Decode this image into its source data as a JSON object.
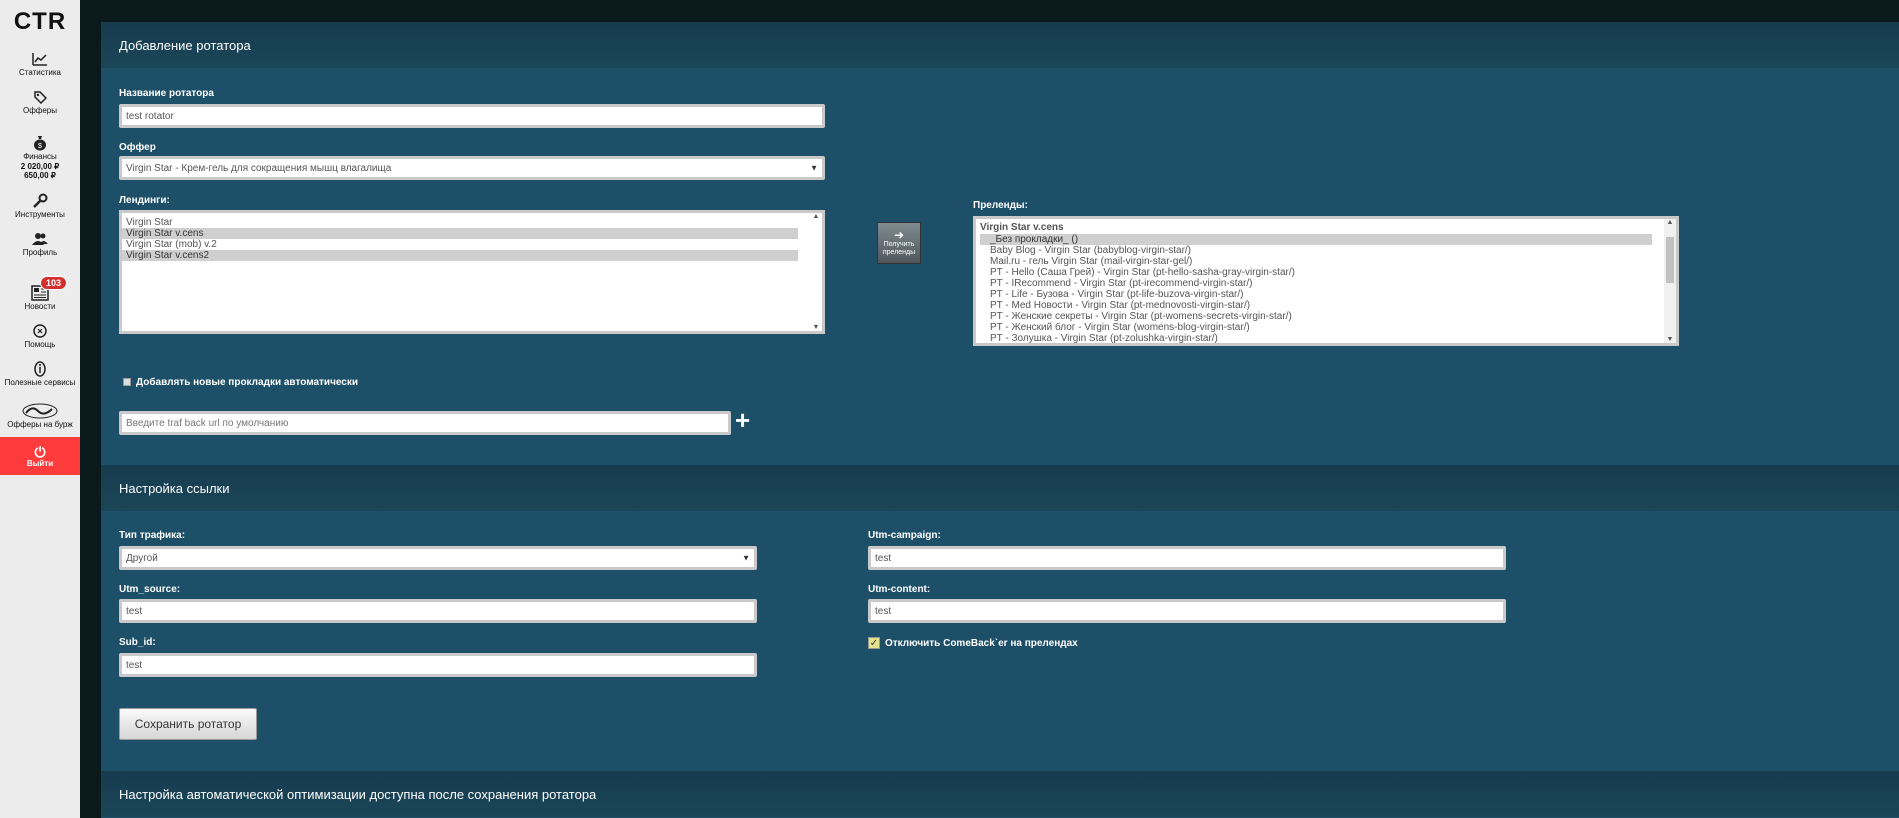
{
  "sidebar": {
    "logo": "CTR",
    "items": [
      {
        "label": "Статистика",
        "icon": "chart-icon"
      },
      {
        "label": "Офферы",
        "icon": "tag-icon"
      },
      {
        "label": "Финансы",
        "icon": "money-bag-icon",
        "balance1": "2 020,00 ₽",
        "balance2": "650,00 ₽"
      },
      {
        "label": "Инструменты",
        "icon": "wrench-icon"
      },
      {
        "label": "Профиль",
        "icon": "users-icon"
      },
      {
        "label": "Новости",
        "icon": "newspaper-icon",
        "badge": "103"
      },
      {
        "label": "Помощь",
        "icon": "help-icon"
      },
      {
        "label": "Полезные сервисы",
        "icon": "info-icon"
      },
      {
        "label": "Офферы на бурж",
        "icon": "adcombo-logo"
      }
    ],
    "logout": {
      "label": "Выйти",
      "icon": "power-icon"
    }
  },
  "section1": {
    "title": "Добавление ротатора",
    "name_label": "Название ротатора",
    "name_value": "test rotator",
    "offer_label": "Оффер",
    "offer_value": "Virgin Star - Крем-гель для сокращения мышц влагалища",
    "landings_label": "Лендинги:",
    "landings": [
      {
        "text": "Virgin Star",
        "selected": false
      },
      {
        "text": "Virgin Star v.cens",
        "selected": true
      },
      {
        "text": "Virgin Star (mob) v.2",
        "selected": false
      },
      {
        "text": "Virgin Star v.cens2",
        "selected": true
      }
    ],
    "get_prelands_btn": "Получить преленды",
    "prelands_label": "Преленды:",
    "prelands_group": "Virgin Star v.cens",
    "prelands": [
      {
        "text": "_Без прокладки_ ()",
        "selected": true
      },
      {
        "text": "Baby Blog - Virgin Star (babyblog-virgin-star/)",
        "selected": false
      },
      {
        "text": "Mail.ru - гель Virgin Star (mail-virgin-star-gel/)",
        "selected": false
      },
      {
        "text": "PT - Hello (Саша Грей) - Virgin Star (pt-hello-sasha-gray-virgin-star/)",
        "selected": false
      },
      {
        "text": "PT - IRecommend - Virgin Star (pt-irecommend-virgin-star/)",
        "selected": false
      },
      {
        "text": "PT - Life - Бузова - Virgin Star (pt-life-buzova-virgin-star/)",
        "selected": false
      },
      {
        "text": "PT - Med Новости - Virgin Star (pt-mednovosti-virgin-star/)",
        "selected": false
      },
      {
        "text": "PT - Женские секреты - Virgin Star (pt-womens-secrets-virgin-star/)",
        "selected": false
      },
      {
        "text": "PT - Женский блог - Virgin Star (womens-blog-virgin-star/)",
        "selected": false
      },
      {
        "text": "PT - Золушка - Virgin Star (pt-zolushka-virgin-star/)",
        "selected": false
      }
    ],
    "auto_add_label": "Добавлять новые прокладки автоматически",
    "trafback_placeholder": "Введите traf back url по умолчанию"
  },
  "section2": {
    "title": "Настройка ссылки",
    "traffic_type_label": "Тип трафика:",
    "traffic_type_value": "Другой",
    "utm_source_label": "Utm_source:",
    "utm_source_value": "test",
    "sub_id_label": "Sub_id:",
    "sub_id_value": "test",
    "utm_campaign_label": "Utm-campaign:",
    "utm_campaign_value": "test",
    "utm_content_label": "Utm-content:",
    "utm_content_value": "test",
    "comeback_label": "Отключить ComeBack`er на прелендах",
    "save_btn": "Сохранить ротатор"
  },
  "section3": {
    "title": "Настройка автоматической оптимизации доступна после сохранения ротатора"
  }
}
